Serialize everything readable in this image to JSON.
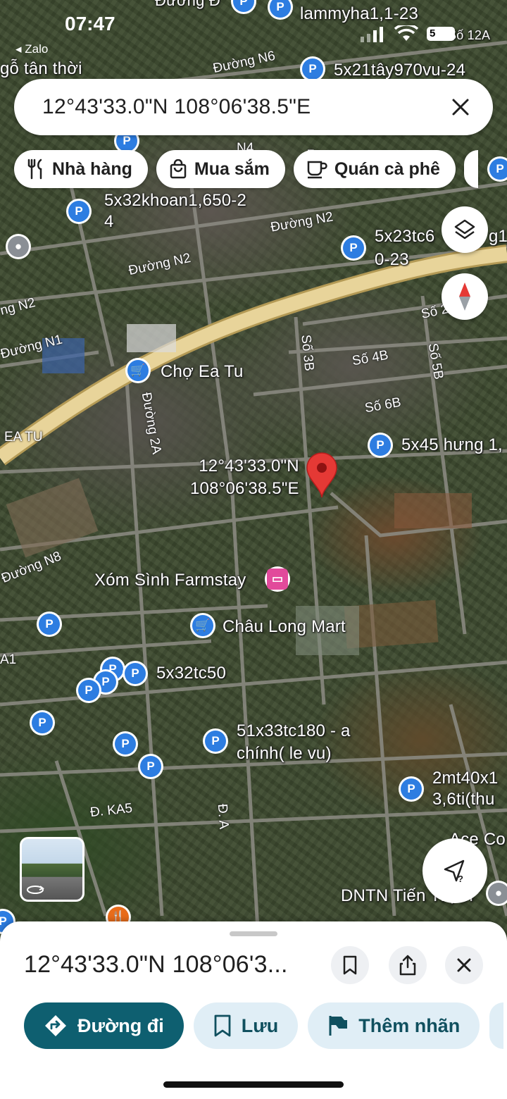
{
  "status_bar": {
    "time": "07:47",
    "back_app": "◂ Zalo",
    "battery": "5"
  },
  "search": {
    "query": "12°43'33.0\"N 108°06'38.5\"E"
  },
  "chips": [
    {
      "label": "Nhà hàng",
      "icon": "fork-knife-icon"
    },
    {
      "label": "Mua sắm",
      "icon": "shopping-bag-icon"
    },
    {
      "label": "Quán cà phê",
      "icon": "coffee-cup-icon"
    }
  ],
  "map": {
    "pin_label": "12°43'33.0\"N\n108°06'38.5\"E",
    "places": {
      "lammyha": "lammyha1,1-23",
      "so12a": "Số 12A",
      "go_tan_thoi": "gỗ tân thời",
      "x21tay": "5x21tây970vu-24",
      "x32khoan": "5x32khoan1,650-2\n4",
      "x23tc": "5x23tc6",
      "x23tc_b": "0-23",
      "g1": "g1",
      "cho_ea_tu": "Chợ Ea Tu",
      "x45": "5x45 hưng 1,",
      "xom_sinh": "Xóm Sình Farmstay",
      "chau_long": "Châu Long Mart",
      "x32tc50": "5x32tc50",
      "x51": "51x33tc180 - a\nchính( le vu)",
      "x2mt40": "2mt40x1\n3,6ti(thu",
      "ace": "Ace Co",
      "dntn": "DNTN Tiến Thịnh",
      "top_cut": "Đường Đ"
    },
    "roads": {
      "n6": "Đường N6",
      "n4": "N4",
      "n2_a": "Đường N2",
      "n2_b": "Đường N2",
      "n2_c": "ng N2",
      "n1": "Đường N1",
      "ea_tu": "EA TU",
      "d2a": "Đường 2A",
      "so3b": "Số 3B",
      "so4b": "Số 4B",
      "so5b": "Số 5B",
      "so6b": "Số 6B",
      "so2": "Số 2",
      "n8": "Đường N8",
      "a1": "A1",
      "ka5": "Đ. KA5",
      "da": "Đ. A",
      "so7": "7"
    }
  },
  "sheet": {
    "title": "12°43'33.0\"N 108°06'3...",
    "actions": [
      {
        "label": "Đường đi",
        "icon": "directions-icon"
      },
      {
        "label": "Lưu",
        "icon": "bookmark-icon"
      },
      {
        "label": "Thêm nhãn",
        "icon": "flag-icon"
      }
    ]
  },
  "colors": {
    "primary": "#0e5f70",
    "chip_bg": "#e0eef6",
    "pin_blue": "#2d7de1",
    "pin_red": "#e53935",
    "highway": "#e8d49a"
  }
}
